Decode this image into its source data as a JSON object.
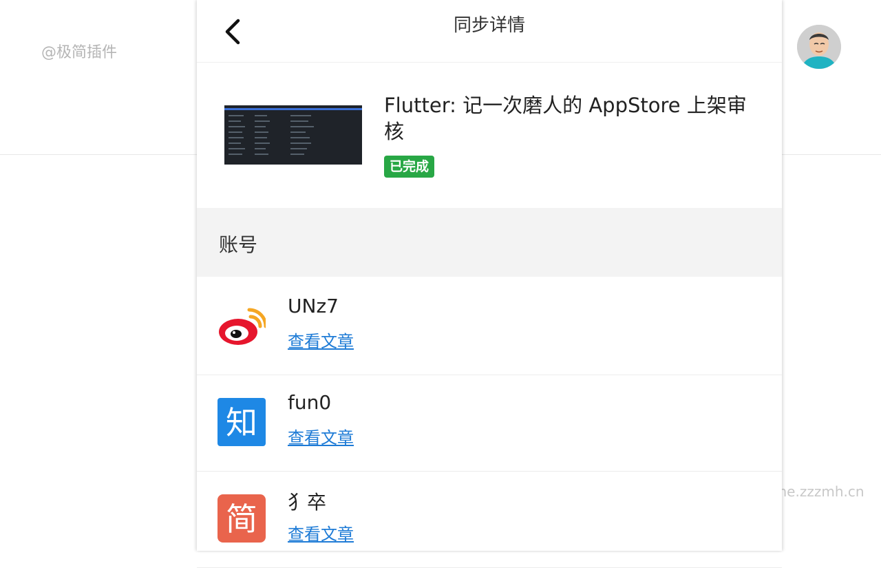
{
  "background": {
    "watermark_left": "@极简插件",
    "watermark_right": "chrome.zzzmh.cn"
  },
  "header": {
    "title": "同步详情",
    "back_icon": "chevron-left-icon"
  },
  "article": {
    "title": "Flutter: 记一次磨人的 AppStore 上架审核",
    "status": "已完成",
    "status_color": "#28a745"
  },
  "accounts": {
    "section_label": "账号",
    "items": [
      {
        "platform_icon": "weibo-icon",
        "name": "UNz7",
        "link": "查看文章"
      },
      {
        "platform_icon": "zhihu-icon",
        "name": "fun0",
        "link": "查看文章"
      },
      {
        "platform_icon": "jianshu-icon",
        "name": "犭卒",
        "link": "查看文章"
      }
    ]
  },
  "colors": {
    "link": "#1e7bd6",
    "zhihu": "#1e88e5",
    "jianshu": "#e9644c",
    "weibo_red": "#e6162d"
  }
}
